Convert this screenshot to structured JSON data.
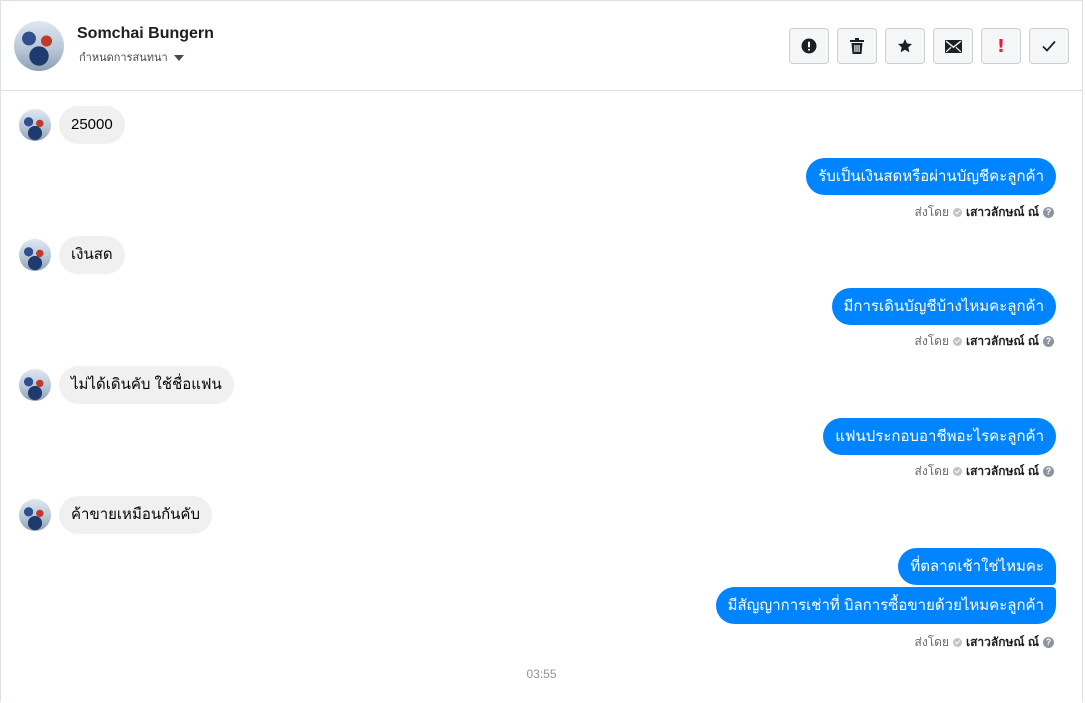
{
  "header": {
    "name": "Somchai Bungern",
    "subtitle": "กำหนดการสนทนา"
  },
  "toolbar": {
    "buttons": [
      "report-icon",
      "trash-icon",
      "star-icon",
      "envelope-icon",
      "important-icon",
      "check-icon"
    ],
    "important_glyph": "!"
  },
  "colors": {
    "accent": "#0084ff",
    "incoming_bubble": "#f0f0f0",
    "important": "#e41e3f"
  },
  "messages": [
    {
      "dir": "in",
      "text": "25000"
    },
    {
      "dir": "out",
      "text": "รับเป็นเงินสดหรือผ่านบัญชีคะลูกค้า"
    },
    {
      "dir": "in",
      "text": "เงินสด"
    },
    {
      "dir": "out",
      "text": "มีการเดินบัญชีบ้างไหมคะลูกค้า"
    },
    {
      "dir": "in",
      "text": "ไม่ได้เดินคับ ใช้ชื่อแฟน"
    },
    {
      "dir": "out",
      "text": "แฟนประกอบอาชีพอะไรคะลูกค้า"
    },
    {
      "dir": "in",
      "text": "ค้าขายเหมือนกันคับ"
    },
    {
      "dir": "out",
      "text": "ที่ตลาดเช้าใช่ไหมคะ"
    },
    {
      "dir": "out",
      "text": "มีสัญญาการเช่าที่ บิลการซื้อขายด้วยไหมคะลูกค้า"
    }
  ],
  "sent_by": {
    "prefix": "ส่งโดย",
    "name": "เสาวลักษณ์ ณ์",
    "help": "?"
  },
  "timestamp": "03:55"
}
